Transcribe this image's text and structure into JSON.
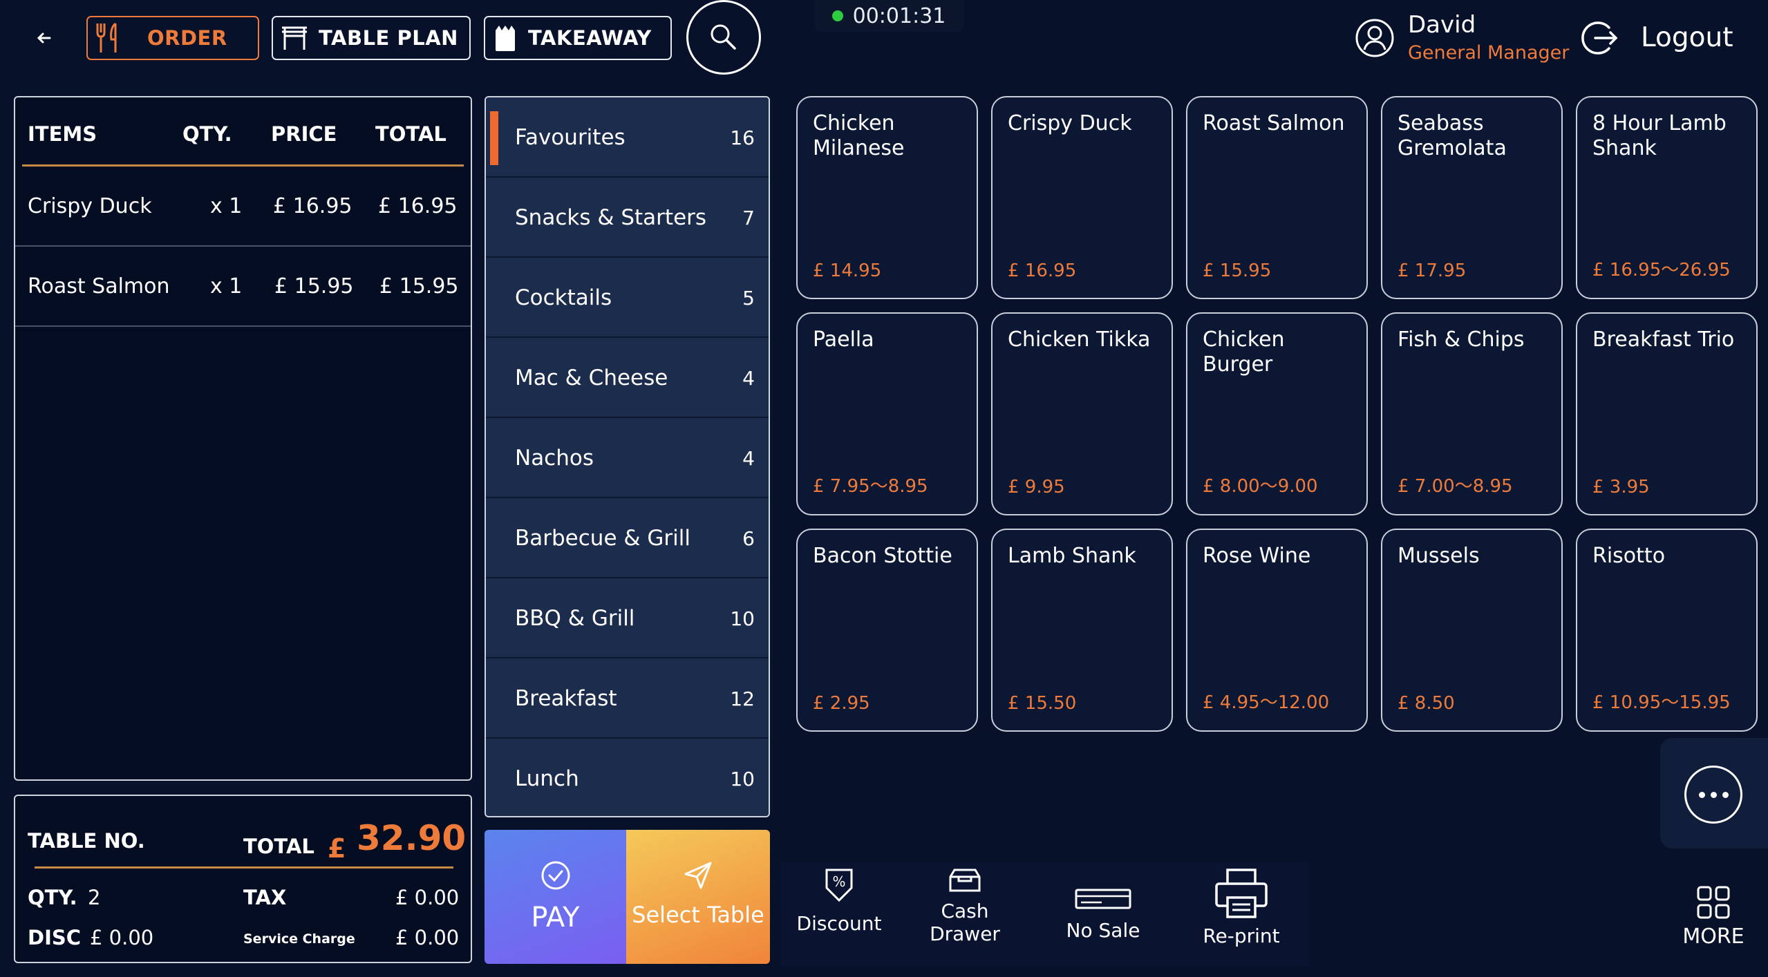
{
  "topbar": {
    "nav": [
      {
        "label": "ORDER",
        "active": true
      },
      {
        "label": "TABLE PLAN",
        "active": false
      },
      {
        "label": "TAKEAWAY",
        "active": false
      }
    ],
    "timer": "00:01:31",
    "user": {
      "name": "David",
      "role": "General Manager"
    },
    "logout": "Logout"
  },
  "order": {
    "headers": {
      "items": "ITEMS",
      "qty": "QTY.",
      "price": "PRICE",
      "total": "TOTAL"
    },
    "rows": [
      {
        "item": "Crispy Duck",
        "qty": "x 1",
        "price": "£ 16.95",
        "total": "£ 16.95"
      },
      {
        "item": "Roast Salmon",
        "qty": "x 1",
        "price": "£ 15.95",
        "total": "£ 15.95"
      }
    ]
  },
  "totals": {
    "table_label": "TABLE NO.",
    "total_label": "TOTAL",
    "currency": "£",
    "total_value": "32.90",
    "qty_label": "QTY.",
    "qty_value": "2",
    "tax_label": "TAX",
    "tax_value": "£ 0.00",
    "disc_label": "DISC",
    "disc_value": "£ 0.00",
    "service_label": "Service Charge",
    "service_value": "£ 0.00"
  },
  "categories": [
    {
      "label": "Favourites",
      "count": "16"
    },
    {
      "label": "Snacks & Starters",
      "count": "7"
    },
    {
      "label": "Cocktails",
      "count": "5"
    },
    {
      "label": "Mac & Cheese",
      "count": "4"
    },
    {
      "label": "Nachos",
      "count": "4"
    },
    {
      "label": "Barbecue & Grill",
      "count": "6"
    },
    {
      "label": "BBQ & Grill",
      "count": "10"
    },
    {
      "label": "Breakfast",
      "count": "12"
    },
    {
      "label": "Lunch",
      "count": "10"
    }
  ],
  "products": [
    {
      "name": "Chicken Milanese",
      "price": "£ 14.95"
    },
    {
      "name": "Crispy Duck",
      "price": "£ 16.95"
    },
    {
      "name": "Roast Salmon",
      "price": "£ 15.95"
    },
    {
      "name": "Seabass Gremolata",
      "price": "£ 17.95"
    },
    {
      "name": "8 Hour Lamb Shank",
      "price": "£ 16.95～26.95"
    },
    {
      "name": "Paella",
      "price": "£ 7.95～8.95"
    },
    {
      "name": "Chicken Tikka",
      "price": "£ 9.95"
    },
    {
      "name": "Chicken Burger",
      "price": "£ 8.00～9.00"
    },
    {
      "name": "Fish & Chips",
      "price": "£ 7.00～8.95"
    },
    {
      "name": "Breakfast Trio",
      "price": "£ 3.95"
    },
    {
      "name": "Bacon Stottie",
      "price": "£ 2.95"
    },
    {
      "name": "Lamb Shank",
      "price": "£ 15.50"
    },
    {
      "name": "Rose Wine",
      "price": "£ 4.95～12.00"
    },
    {
      "name": "Mussels",
      "price": "£ 8.50"
    },
    {
      "name": "Risotto",
      "price": "£ 10.95～15.95"
    }
  ],
  "actions": {
    "pay": "PAY",
    "select_table": "Select Table",
    "discount": "Discount",
    "cash_drawer_1": "Cash",
    "cash_drawer_2": "Drawer",
    "no_sale": "No Sale",
    "reprint": "Re-print",
    "more": "MORE"
  },
  "colors": {
    "background": "#07112a",
    "accent": "#ef7b3b",
    "pay_gradient": [
      "#5b84ee",
      "#7a5ff1"
    ],
    "select_gradient": [
      "#f5c95a",
      "#f0843a"
    ]
  }
}
